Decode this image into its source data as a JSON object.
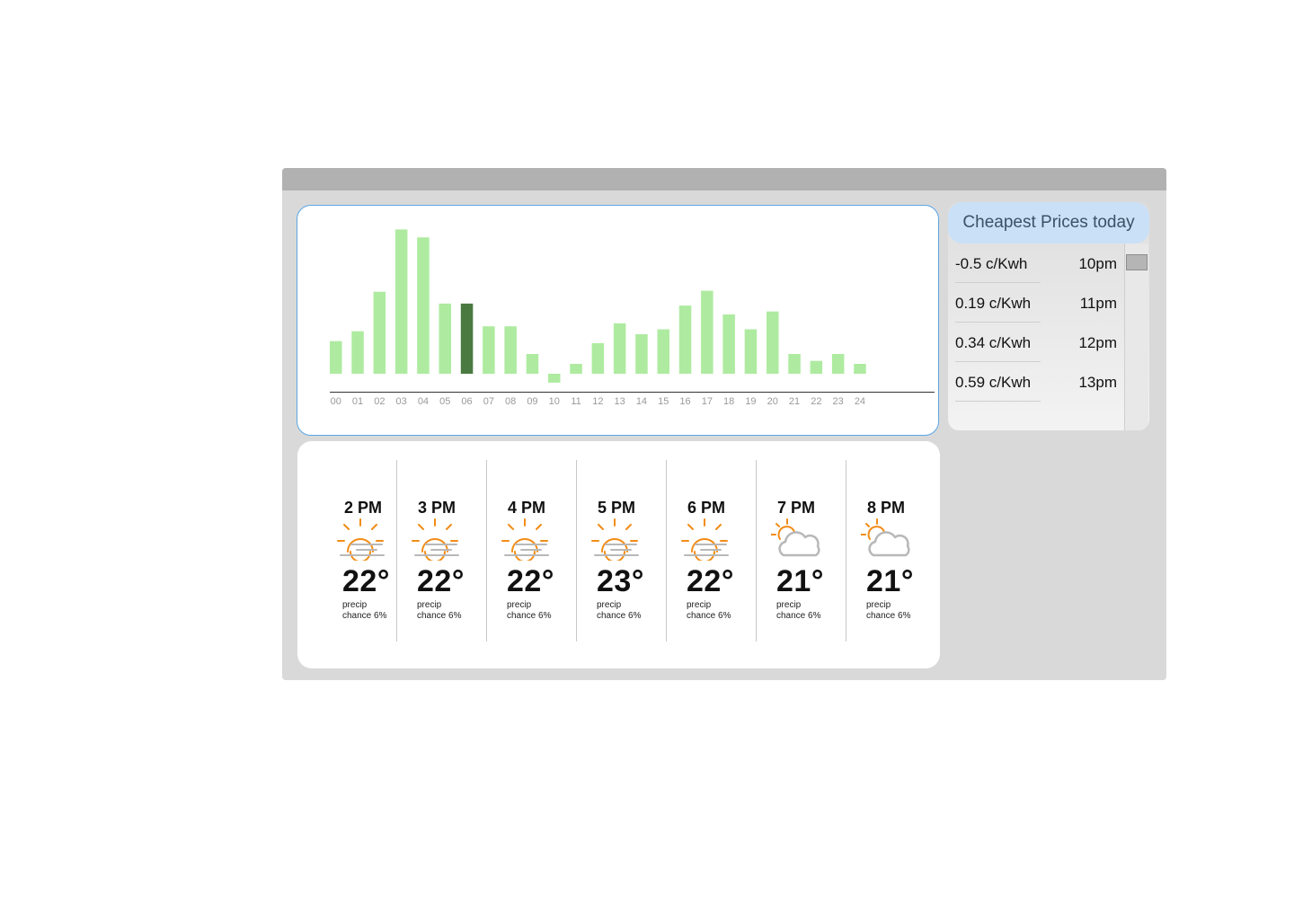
{
  "chart_data": {
    "type": "bar",
    "categories": [
      "00",
      "01",
      "02",
      "03",
      "04",
      "05",
      "06",
      "07",
      "08",
      "09",
      "10",
      "11",
      "12",
      "13",
      "14",
      "15",
      "16",
      "17",
      "18",
      "19",
      "20",
      "21",
      "22",
      "23",
      "24"
    ],
    "values": [
      3.3,
      4.3,
      8.3,
      14.6,
      13.8,
      7.1,
      7.1,
      4.8,
      4.8,
      2.0,
      -0.9,
      1.0,
      3.1,
      5.1,
      4.0,
      4.5,
      6.9,
      8.4,
      6.0,
      4.5,
      6.3,
      2.0,
      1.3,
      2.0,
      1.0
    ],
    "highlight_index": 6,
    "ylim": [
      -2,
      16
    ],
    "grid": false,
    "colors": {
      "bar": "#aeeba0",
      "highlight": "#4a7a40",
      "axis": "#333333",
      "tick": "#9a9a9a"
    }
  },
  "prices": {
    "title": "Cheapest Prices today",
    "rows": [
      {
        "value": "-0.5 c/Kwh",
        "time": "10pm"
      },
      {
        "value": "0.19 c/Kwh",
        "time": "11pm"
      },
      {
        "value": "0.34 c/Kwh",
        "time": "12pm"
      },
      {
        "value": "0.59 c/Kwh",
        "time": "13pm"
      }
    ]
  },
  "forecast": [
    {
      "time": "2 PM",
      "icon": "sunset-icon",
      "temp": "22°",
      "precip_label": "precip",
      "precip_value": "chance 6%"
    },
    {
      "time": "3 PM",
      "icon": "sunset-icon",
      "temp": "22°",
      "precip_label": "precip",
      "precip_value": "chance 6%"
    },
    {
      "time": "4 PM",
      "icon": "sunset-icon",
      "temp": "22°",
      "precip_label": "precip",
      "precip_value": "chance 6%"
    },
    {
      "time": "5 PM",
      "icon": "sunset-icon",
      "temp": "23°",
      "precip_label": "precip",
      "precip_value": "chance 6%"
    },
    {
      "time": "6 PM",
      "icon": "sunset-icon",
      "temp": "22°",
      "precip_label": "precip",
      "precip_value": "chance 6%"
    },
    {
      "time": "7 PM",
      "icon": "partly-cloudy-icon",
      "temp": "21°",
      "precip_label": "precip",
      "precip_value": "chance 6%"
    },
    {
      "time": "8 PM",
      "icon": "partly-cloudy-icon",
      "temp": "21°",
      "precip_label": "precip",
      "precip_value": "chance 6%"
    }
  ],
  "colors": {
    "sun": "#f28c16",
    "cloud": "#b8b8b8",
    "accent_border": "#5aa6e6",
    "header_bg": "#c9e0f7"
  }
}
